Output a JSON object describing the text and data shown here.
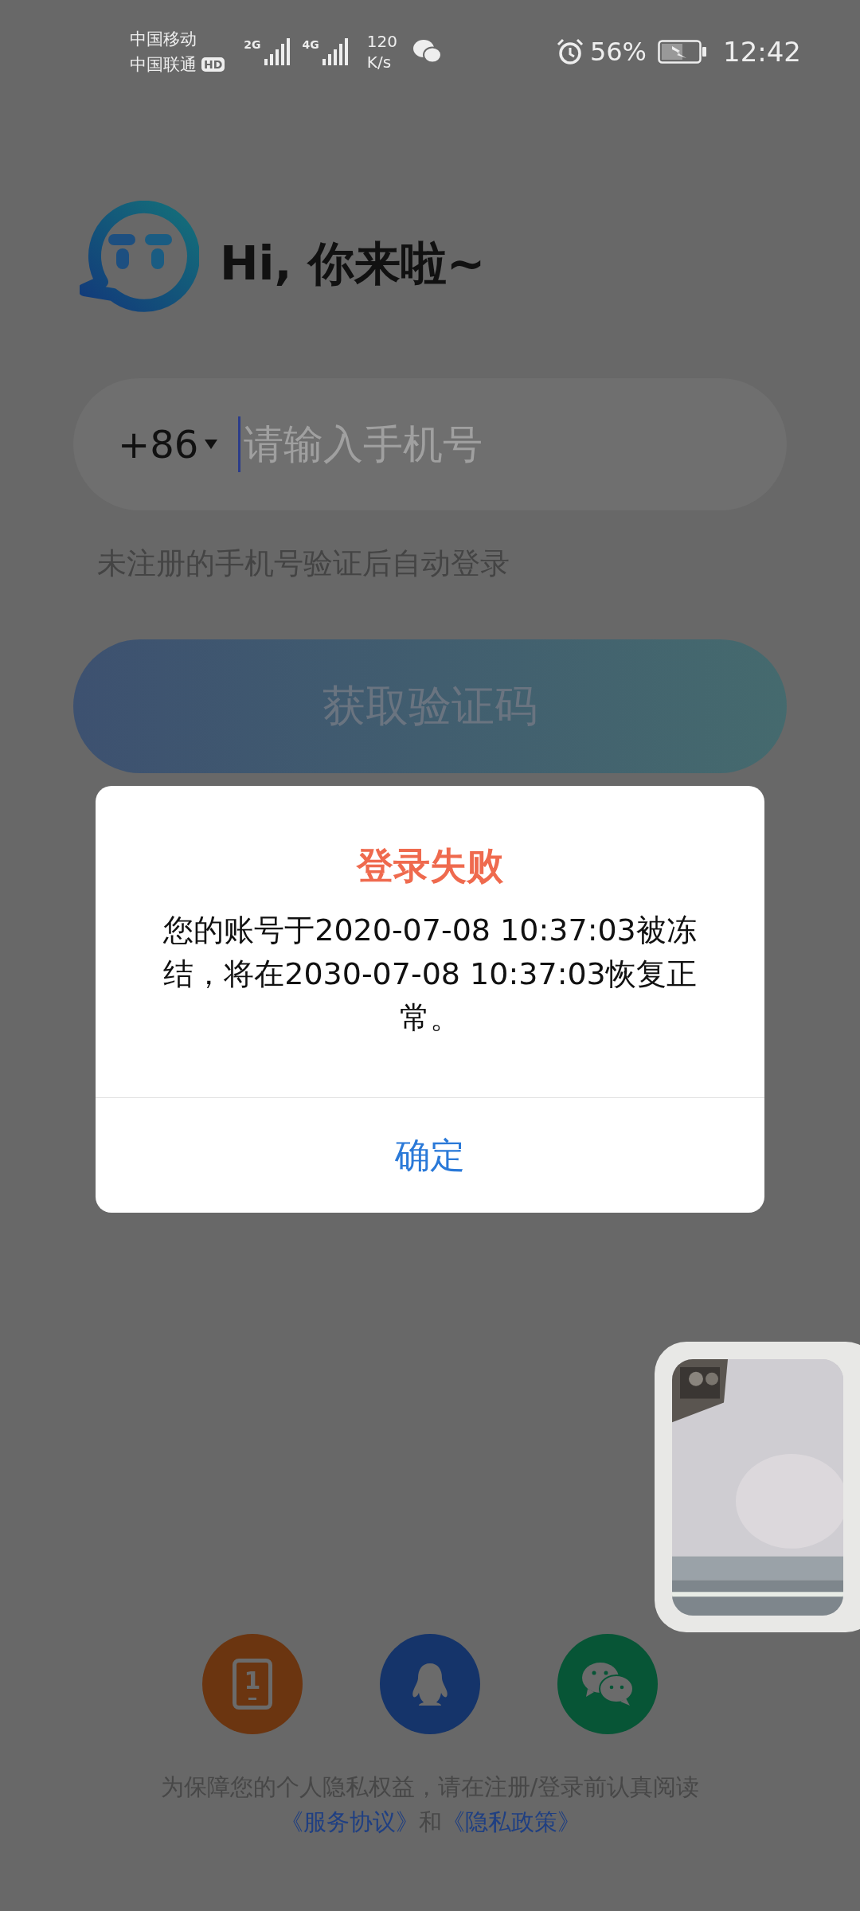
{
  "status_bar": {
    "carriers": [
      "中国移动",
      "中国联通"
    ],
    "hd_badge": "HD",
    "networks": [
      "2G",
      "4G"
    ],
    "speed_value": "120",
    "speed_unit": "K/s",
    "battery": "56%",
    "charging": true,
    "time": "12:42"
  },
  "greeting": "Hi, 你来啦~",
  "phone_field": {
    "country_code": "+86",
    "placeholder": "请输入手机号"
  },
  "hint": "未注册的手机号验证后自动登录",
  "primary_button": "获取验证码",
  "dialog": {
    "title": "登录失败",
    "message": "您的账号于2020-07-08 10:37:03被冻结，将在2030-07-08 10:37:03恢复正常。",
    "button": "确定"
  },
  "social_logins": [
    {
      "kind": "phone",
      "color": "#6b3510",
      "label": "1"
    },
    {
      "kind": "qq",
      "color": "#15346a"
    },
    {
      "kind": "wechat",
      "color": "#075536"
    }
  ],
  "privacy": {
    "text": "为保障您的个人隐私权益，请在注册/登录前认真阅读",
    "link_1": "《服务协议》",
    "conjunction": "和",
    "link_2": "《隐私政策》"
  }
}
